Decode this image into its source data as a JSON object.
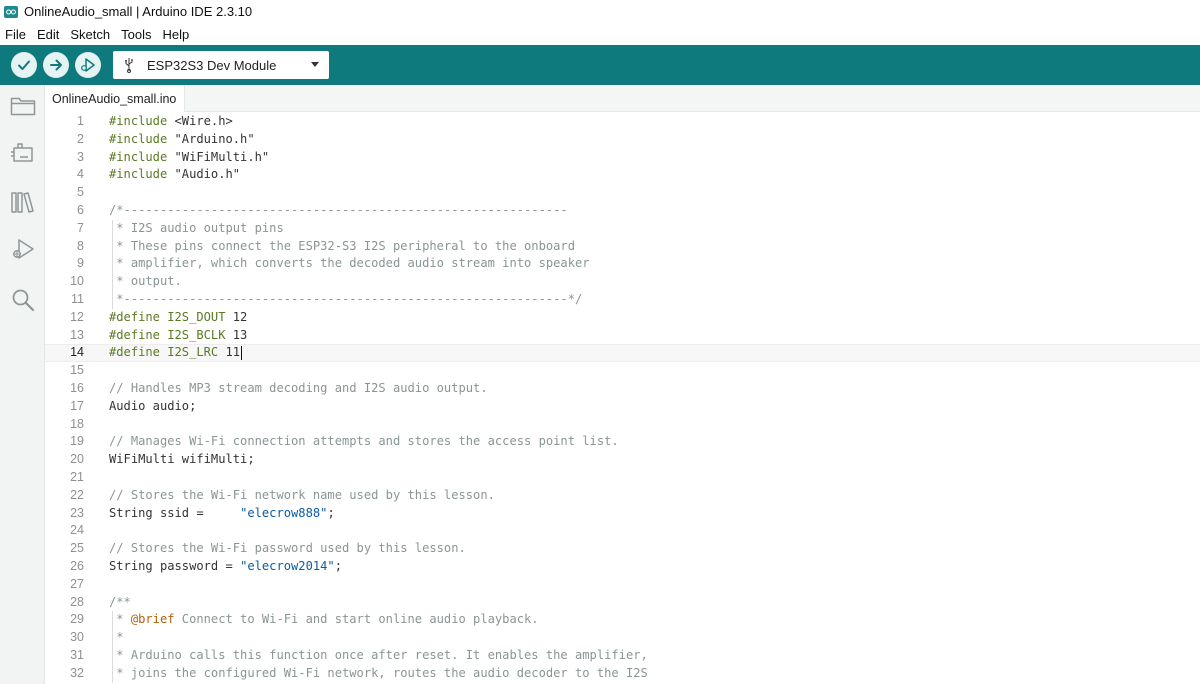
{
  "window": {
    "title": "OnlineAudio_small | Arduino IDE 2.3.10"
  },
  "menu": [
    "File",
    "Edit",
    "Sketch",
    "Tools",
    "Help"
  ],
  "toolbar": {
    "verify_icon": "check-icon",
    "upload_icon": "arrow-right-icon",
    "debug_icon": "debug-icon",
    "board_icon": "usb-icon",
    "board": "ESP32S3 Dev Module",
    "accent_color": "#0f7a7e"
  },
  "sidebar": {
    "icons": [
      "folder-icon",
      "board-manager-icon",
      "library-icon",
      "debug-icon",
      "search-icon"
    ]
  },
  "tab": {
    "filename": "OnlineAudio_small.ino"
  },
  "editor": {
    "active_line": 14,
    "lines": [
      {
        "n": "1",
        "parts": [
          [
            "#include ",
            "pp"
          ],
          [
            "<Wire.h>",
            "plain"
          ]
        ]
      },
      {
        "n": "2",
        "parts": [
          [
            "#include ",
            "pp"
          ],
          [
            "\"Arduino.h\"",
            "plain"
          ]
        ]
      },
      {
        "n": "3",
        "parts": [
          [
            "#include ",
            "pp"
          ],
          [
            "\"WiFiMulti.h\"",
            "plain"
          ]
        ]
      },
      {
        "n": "4",
        "parts": [
          [
            "#include ",
            "pp"
          ],
          [
            "\"Audio.h\"",
            "plain"
          ]
        ]
      },
      {
        "n": "5",
        "parts": []
      },
      {
        "n": "6",
        "parts": [
          [
            "/*-------------------------------------------------------------",
            "com"
          ]
        ]
      },
      {
        "n": "7",
        "parts": [
          [
            " * I2S audio output pins",
            "com"
          ]
        ],
        "fold": true
      },
      {
        "n": "8",
        "parts": [
          [
            " * These pins connect the ESP32-S3 I2S peripheral to the onboard",
            "com"
          ]
        ],
        "fold": true
      },
      {
        "n": "9",
        "parts": [
          [
            " * amplifier, which converts the decoded audio stream into speaker",
            "com"
          ]
        ],
        "fold": true
      },
      {
        "n": "10",
        "parts": [
          [
            " * output.",
            "com"
          ]
        ],
        "fold": true
      },
      {
        "n": "11",
        "parts": [
          [
            " *-------------------------------------------------------------*/",
            "com"
          ]
        ],
        "fold": true
      },
      {
        "n": "12",
        "parts": [
          [
            "#define I2S_DOUT ",
            "pp"
          ],
          [
            "12",
            "plain"
          ]
        ]
      },
      {
        "n": "13",
        "parts": [
          [
            "#define I2S_BCLK ",
            "pp"
          ],
          [
            "13",
            "plain"
          ]
        ]
      },
      {
        "n": "14",
        "parts": [
          [
            "#define I2S_LRC ",
            "pp"
          ],
          [
            "11",
            "plain"
          ]
        ],
        "cursor": true
      },
      {
        "n": "15",
        "parts": []
      },
      {
        "n": "16",
        "parts": [
          [
            "// Handles MP3 stream decoding and I2S audio output.",
            "com"
          ]
        ]
      },
      {
        "n": "17",
        "parts": [
          [
            "Audio audio;",
            "plain"
          ]
        ]
      },
      {
        "n": "18",
        "parts": []
      },
      {
        "n": "19",
        "parts": [
          [
            "// Manages Wi-Fi connection attempts and stores the access point list.",
            "com"
          ]
        ]
      },
      {
        "n": "20",
        "parts": [
          [
            "WiFiMulti wifiMulti;",
            "plain"
          ]
        ]
      },
      {
        "n": "21",
        "parts": []
      },
      {
        "n": "22",
        "parts": [
          [
            "// Stores the Wi-Fi network name used by this lesson.",
            "com"
          ]
        ]
      },
      {
        "n": "23",
        "parts": [
          [
            "String ssid =     ",
            "plain"
          ],
          [
            "\"elecrow888\"",
            "str"
          ],
          [
            ";",
            "plain"
          ]
        ]
      },
      {
        "n": "24",
        "parts": []
      },
      {
        "n": "25",
        "parts": [
          [
            "// Stores the Wi-Fi password used by this lesson.",
            "com"
          ]
        ]
      },
      {
        "n": "26",
        "parts": [
          [
            "String password = ",
            "plain"
          ],
          [
            "\"elecrow2014\"",
            "str"
          ],
          [
            ";",
            "plain"
          ]
        ]
      },
      {
        "n": "27",
        "parts": []
      },
      {
        "n": "28",
        "parts": [
          [
            "/**",
            "com"
          ]
        ]
      },
      {
        "n": "29",
        "parts": [
          [
            " * ",
            "com"
          ],
          [
            "@brief",
            "kw"
          ],
          [
            " Connect to Wi-Fi and start online audio playback.",
            "com"
          ]
        ],
        "fold": true
      },
      {
        "n": "30",
        "parts": [
          [
            " *",
            "com"
          ]
        ],
        "fold": true
      },
      {
        "n": "31",
        "parts": [
          [
            " * Arduino calls this function once after reset. It enables the amplifier,",
            "com"
          ]
        ],
        "fold": true
      },
      {
        "n": "32",
        "parts": [
          [
            " * joins the configured Wi-Fi network, routes the audio decoder to the I2S",
            "com"
          ]
        ],
        "fold": true
      }
    ]
  }
}
